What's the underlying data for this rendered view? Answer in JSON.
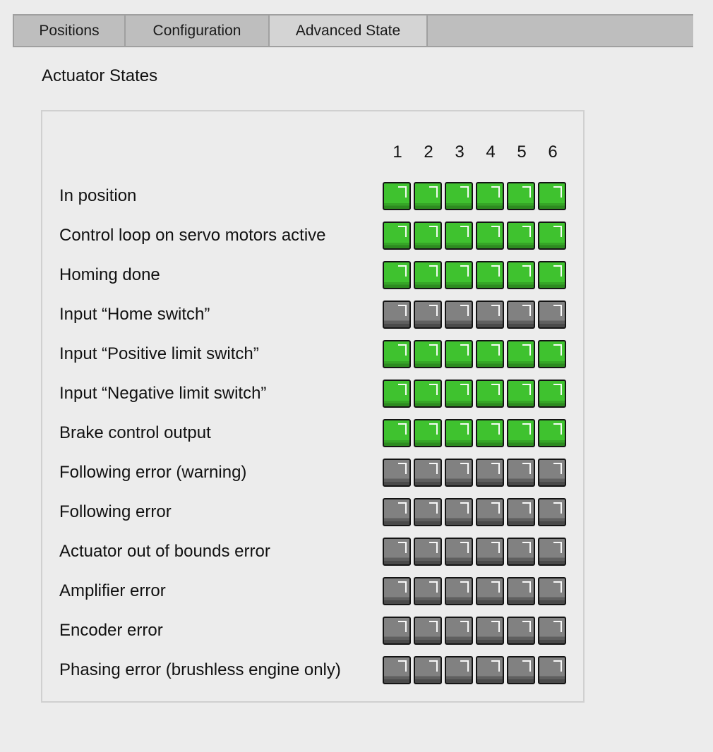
{
  "tabs": [
    {
      "label": "Positions",
      "active": false
    },
    {
      "label": "Configuration",
      "active": false
    },
    {
      "label": "Advanced State",
      "active": true
    }
  ],
  "section_title": "Actuator States",
  "columns": [
    "1",
    "2",
    "3",
    "4",
    "5",
    "6"
  ],
  "colors": {
    "on": "#3fc22f",
    "off": "#818181"
  },
  "rows": [
    {
      "label": "In position",
      "states": [
        true,
        true,
        true,
        true,
        true,
        true
      ]
    },
    {
      "label": "Control loop on servo motors active",
      "states": [
        true,
        true,
        true,
        true,
        true,
        true
      ]
    },
    {
      "label": "Homing done",
      "states": [
        true,
        true,
        true,
        true,
        true,
        true
      ]
    },
    {
      "label": "Input “Home switch”",
      "states": [
        false,
        false,
        false,
        false,
        false,
        false
      ]
    },
    {
      "label": "Input “Positive limit switch”",
      "states": [
        true,
        true,
        true,
        true,
        true,
        true
      ]
    },
    {
      "label": "Input “Negative limit switch”",
      "states": [
        true,
        true,
        true,
        true,
        true,
        true
      ]
    },
    {
      "label": "Brake control output",
      "states": [
        true,
        true,
        true,
        true,
        true,
        true
      ]
    },
    {
      "label": "Following error (warning)",
      "states": [
        false,
        false,
        false,
        false,
        false,
        false
      ]
    },
    {
      "label": "Following error",
      "states": [
        false,
        false,
        false,
        false,
        false,
        false
      ]
    },
    {
      "label": "Actuator out of bounds error",
      "states": [
        false,
        false,
        false,
        false,
        false,
        false
      ]
    },
    {
      "label": "Amplifier error",
      "states": [
        false,
        false,
        false,
        false,
        false,
        false
      ]
    },
    {
      "label": "Encoder error",
      "states": [
        false,
        false,
        false,
        false,
        false,
        false
      ]
    },
    {
      "label": "Phasing error (brushless engine only)",
      "states": [
        false,
        false,
        false,
        false,
        false,
        false
      ]
    }
  ]
}
